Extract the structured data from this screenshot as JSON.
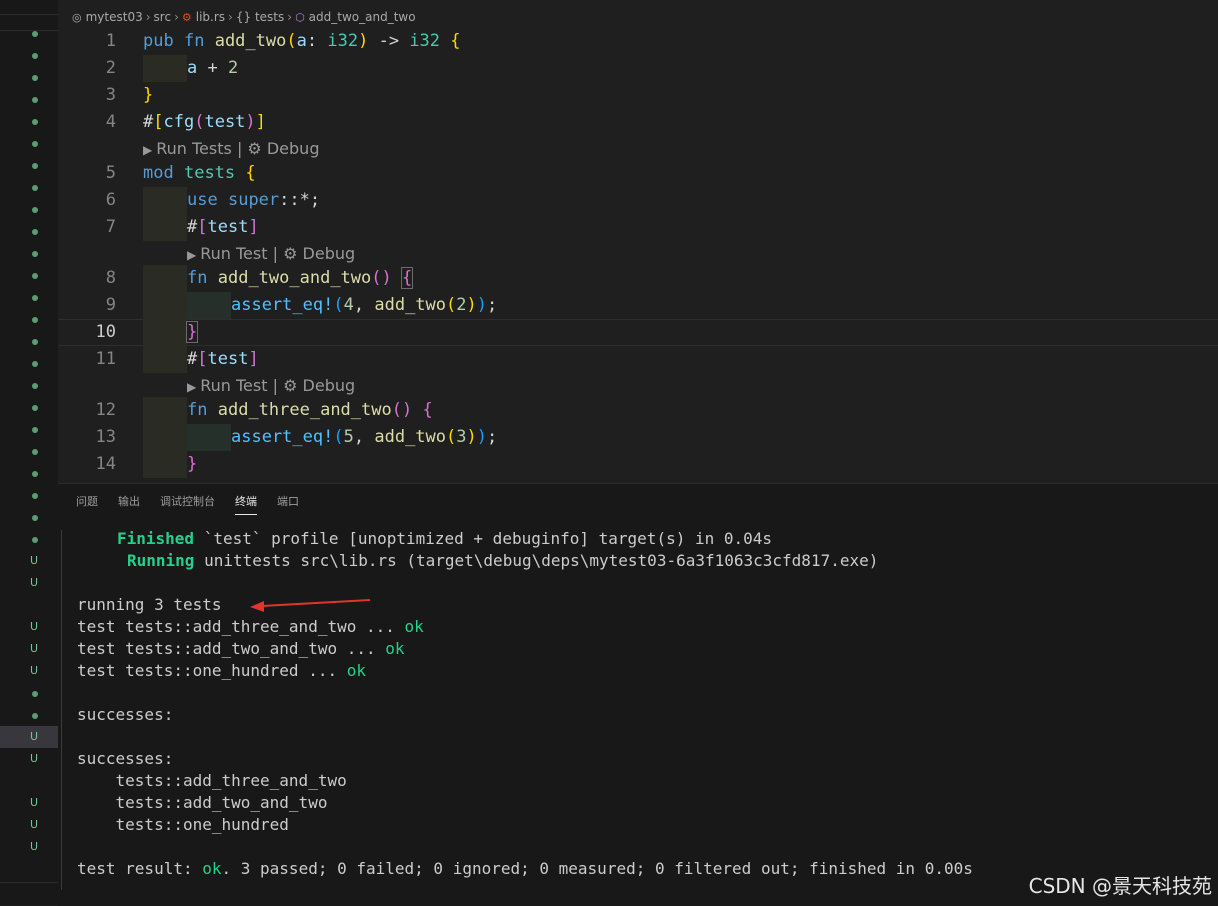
{
  "breadcrumb": [
    {
      "icon": "repo-icon",
      "label": "mytest03"
    },
    {
      "icon": "",
      "label": "src"
    },
    {
      "icon": "rust-icon",
      "label": "lib.rs"
    },
    {
      "icon": "braces-icon",
      "label": "{} tests"
    },
    {
      "icon": "cube-icon",
      "label": "add_two_and_two"
    }
  ],
  "editor": {
    "line_numbers": [
      "1",
      "2",
      "3",
      "4",
      "5",
      "6",
      "7",
      "8",
      "9",
      "10",
      "11",
      "12",
      "13",
      "14"
    ],
    "active_line": "10",
    "code_lens": {
      "run_tests": "Run Tests",
      "run_test": "Run Test",
      "separator": "|",
      "debug": "Debug"
    }
  },
  "panel": {
    "tabs": [
      "问题",
      "输出",
      "调试控制台",
      "终端",
      "端口"
    ],
    "active_tab": "终端",
    "terminal": {
      "finished_label": "Finished",
      "finished_rest": " `test` profile [unoptimized + debuginfo] target(s) in 0.04s",
      "running_label": "Running",
      "running_rest": " unittests src\\lib.rs (target\\debug\\deps\\mytest03-6a3f1063c3cfd817.exe)",
      "running_count": "running 3 tests",
      "tests": [
        {
          "text": "test tests::add_three_and_two ... ",
          "status": "ok"
        },
        {
          "text": "test tests::add_two_and_two ... ",
          "status": "ok"
        },
        {
          "text": "test tests::one_hundred ... ",
          "status": "ok"
        }
      ],
      "successes_1": "successes:",
      "successes_2": "successes:",
      "success_list": [
        "    tests::add_three_and_two",
        "    tests::add_two_and_two",
        "    tests::one_hundred"
      ],
      "result_prefix": "test result: ",
      "result_status": "ok",
      "result_rest": ". 3 passed; 0 failed; 0 ignored; 0 measured; 0 filtered out; finished in 0.00s"
    }
  },
  "watermark": "CSDN @景天科技苑",
  "colors": {
    "ok": "#23d18b",
    "arrow": "#e0352b"
  }
}
